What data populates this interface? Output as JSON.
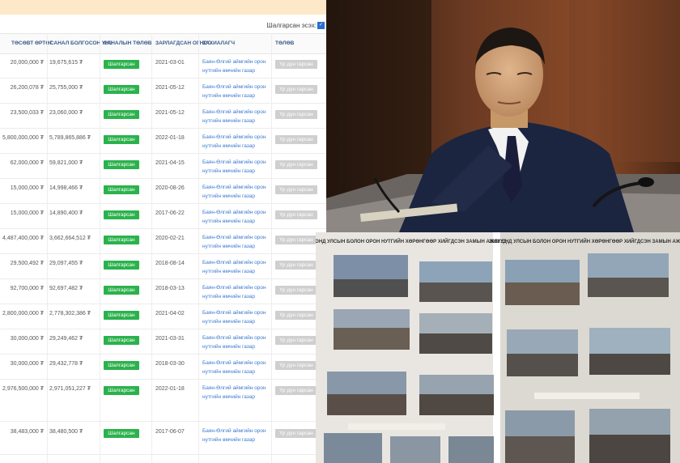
{
  "filter": {
    "label": "Шалгарсан эсэх:",
    "checked": true
  },
  "columns": {
    "budget": "ТӨСӨВТ ӨРТӨГ",
    "offer": "САНАЛ БОЛГОСОН ҮНЭ",
    "status": "САНАЛЫН ТӨЛӨВ",
    "date": "ЗАРЛАГДСАН ОГНОО",
    "client": "ЗАХИАЛАГЧ",
    "payment": "ТӨЛӨВ"
  },
  "rows": [
    {
      "budget": "20,000,000 ₮",
      "offer": "19,675,615 ₮",
      "status": "Шалгарсан",
      "date": "2021-03-01",
      "client": "Баян-Өлгий аймгийн орон нутгийн өмчийн газар",
      "payment": "Үр дүн гарсан"
    },
    {
      "budget": "26,200,078 ₮",
      "offer": "25,755,000 ₮",
      "status": "Шалгарсан",
      "date": "2021-05-12",
      "client": "Баян-Өлгий аймгийн орон нутгийн өмчийн газар",
      "payment": "Үр дүн гарсан"
    },
    {
      "budget": "23,500,033 ₮",
      "offer": "23,060,000 ₮",
      "status": "Шалгарсан",
      "date": "2021-05-12",
      "client": "Баян-Өлгий аймгийн орон нутгийн өмчийн газар",
      "payment": "Үр дүн гарсан"
    },
    {
      "budget": "5,800,000,000 ₮",
      "offer": "5,789,865,886 ₮",
      "status": "Шалгарсан",
      "date": "2022-01-18",
      "client": "Баян-Өлгий аймгийн орон нутгийн өмчийн газар",
      "payment": "Үр дүн гарсан"
    },
    {
      "budget": "62,000,000 ₮",
      "offer": "59,821,000 ₮",
      "status": "Шалгарсан",
      "date": "2021-04-15",
      "client": "Баян-Өлгий аймгийн орон нутгийн өмчийн газар",
      "payment": "Үр дүн гарсан"
    },
    {
      "budget": "15,000,000 ₮",
      "offer": "14,998,466 ₮",
      "status": "Шалгарсан",
      "date": "2020-08-26",
      "client": "Баян-Өлгий аймгийн орон нутгийн өмчийн газар",
      "payment": "Үр дүн гарсан"
    },
    {
      "budget": "15,000,000 ₮",
      "offer": "14,890,400 ₮",
      "status": "Шалгарсан",
      "date": "2017-06-22",
      "client": "Баян-Өлгий аймгийн орон нутгийн өмчийн газар",
      "payment": "Үр дүн гарсан"
    },
    {
      "budget": "4,487,400,000 ₮",
      "offer": "3,662,664,512 ₮",
      "status": "Шалгарсан",
      "date": "2020-02-21",
      "client": "Баян-Өлгий аймгийн орон нутгийн өмчийн газар",
      "payment": "Үр дүн гарсан"
    },
    {
      "budget": "29,500,492 ₮",
      "offer": "29,097,455 ₮",
      "status": "Шалгарсан",
      "date": "2018-08-14",
      "client": "Баян-Өлгий аймгийн орон нутгийн өмчийн газар",
      "payment": "Үр дүн гарсан"
    },
    {
      "budget": "92,700,000 ₮",
      "offer": "92,697,482 ₮",
      "status": "Шалгарсан",
      "date": "2018-03-13",
      "client": "Баян-Өлгий аймгийн орон нутгийн өмчийн газар",
      "payment": "Үр дүн гарсан"
    },
    {
      "budget": "2,800,000,000 ₮",
      "offer": "2,778,302,386 ₮",
      "status": "Шалгарсан",
      "date": "2021-04-02",
      "client": "Баян-Өлгий аймгийн орон нутгийн өмчийн газар",
      "payment": "Үр дүн гарсан"
    },
    {
      "budget": "30,000,000 ₮",
      "offer": "29,249,462 ₮",
      "status": "Шалгарсан",
      "date": "2021-03-31",
      "client": "Баян-Өлгий аймгийн орон нутгийн өмчийн газар",
      "payment": "Үр дүн гарсан"
    },
    {
      "budget": "30,000,000 ₮",
      "offer": "29,432,778 ₮",
      "status": "Шалгарсан",
      "date": "2018-03-30",
      "client": "Баян-Өлгий аймгийн орон нутгийн өмчийн газар",
      "payment": "Үр дүн гарсан"
    },
    {
      "budget": "2,976,500,000 ₮",
      "offer": "2,971,051,227 ₮",
      "status": "Шалгарсан",
      "date": "2022-01-18",
      "client": "Баян-Өлгий аймгийн орон нутгийн өмчийн газар",
      "payment": "Үр дүн гарсан"
    },
    {
      "budget": "38,483,000 ₮",
      "offer": "38,480,500 ₮",
      "status": "Шалгарсан",
      "date": "2017-06-07",
      "client": "Баян-Өлгий аймгийн орон нутгийн өмчийн газар",
      "payment": "Үр дүн гарсан"
    }
  ],
  "booklet": {
    "left_title": "2018 ОНД УЛСЫН БОЛОН ОРОН НУТГИЙН ХӨРӨНГӨӨР ХИЙГДСЭН ЗАМЫН АЖЛУУД",
    "right_title": "2018 ОНД УЛСЫН БОЛОН ОРОН НУТГИЙН ХӨРӨНГӨӨР ХИЙГДСЭН ЗАМЫН АЖЛУУД"
  },
  "colors": {
    "status_green": "#2bb24c",
    "link_blue": "#3b7ad0",
    "top_band": "#fde8c8",
    "pay_badge": "#cfcfcf"
  }
}
